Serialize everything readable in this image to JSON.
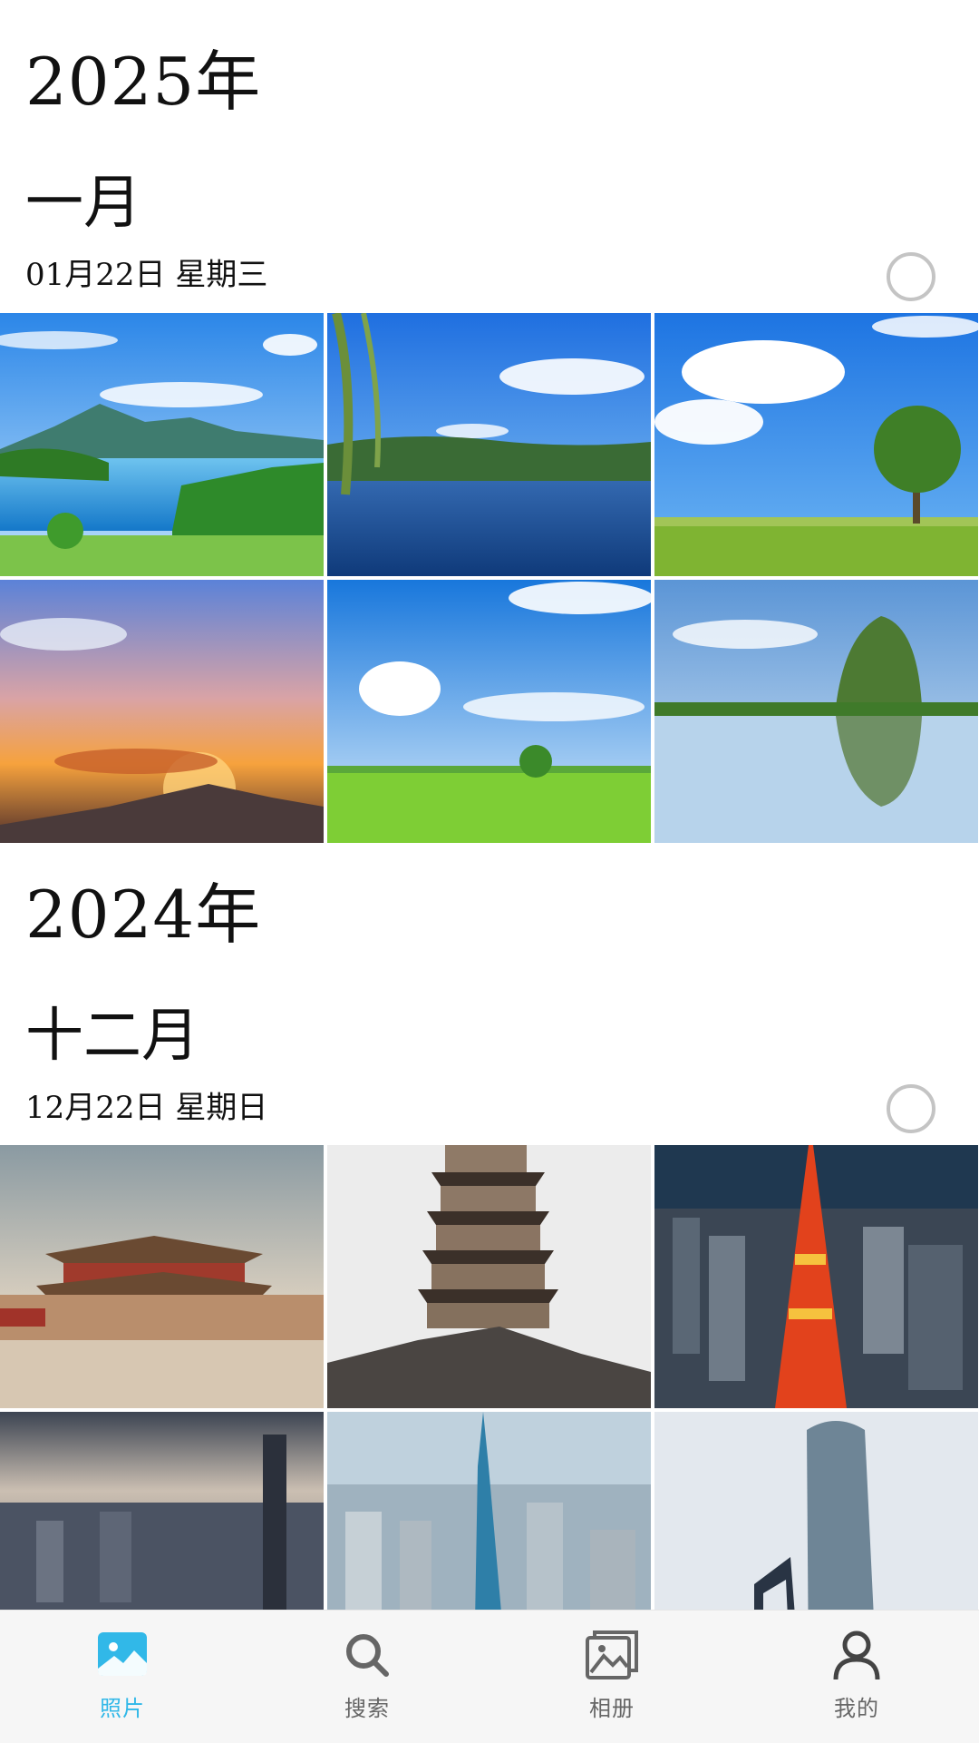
{
  "sections": [
    {
      "year": "2025年",
      "month": "一月",
      "date": "01月22日  星期三",
      "photos": [
        "lake-mountain",
        "lake-willow",
        "grassland-tree",
        "sunset-sky",
        "rice-field",
        "karst-reflection"
      ]
    },
    {
      "year": "2024年",
      "month": "十二月",
      "date": "12月22日  星期日",
      "photos": [
        "forbidden-city",
        "ancient-pagoda",
        "tokyo-tower",
        "shanghai-skyline",
        "skyscraper-haze",
        "shanghai-tower"
      ]
    }
  ],
  "bottom_nav": [
    {
      "label": "照片",
      "icon": "photo-icon",
      "active": true
    },
    {
      "label": "搜索",
      "icon": "search-icon",
      "active": false
    },
    {
      "label": "相册",
      "icon": "album-icon",
      "active": false
    },
    {
      "label": "我的",
      "icon": "profile-icon",
      "active": false
    }
  ],
  "colors": {
    "accent": "#31b8e8",
    "nav_inactive": "#666666",
    "nav_background": "#f6f6f6"
  }
}
